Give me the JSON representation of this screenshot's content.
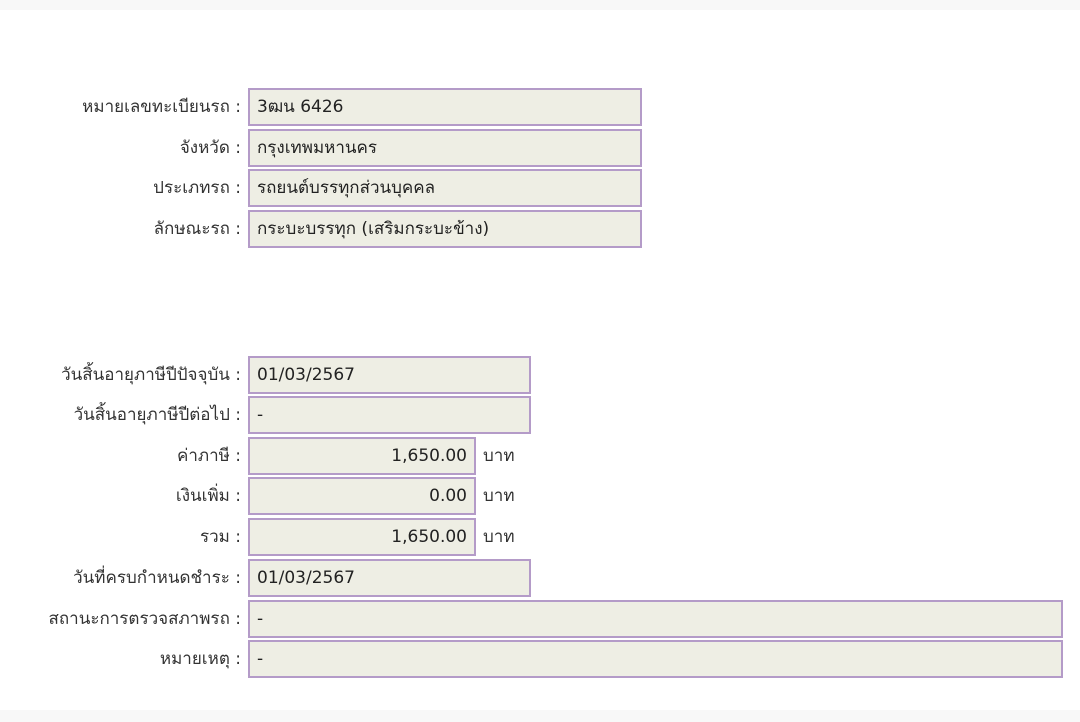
{
  "vehicle": {
    "plate": {
      "label": "หมายเลขทะเบียนรถ :",
      "value": "3ฒน 6426"
    },
    "province": {
      "label": "จังหวัด :",
      "value": "กรุงเทพมหานคร"
    },
    "type": {
      "label": "ประเภทรถ :",
      "value": "รถยนต์บรรทุกส่วนบุคคล"
    },
    "style": {
      "label": "ลักษณะรถ :",
      "value": "กระบะบรรทุก (เสริมกระบะข้าง)"
    }
  },
  "tax": {
    "current_expiry": {
      "label": "วันสิ้นอายุภาษีปีปัจจุบัน :",
      "value": "01/03/2567"
    },
    "next_expiry": {
      "label": "วันสิ้นอายุภาษีปีต่อไป :",
      "value": "-"
    },
    "tax_amount": {
      "label": "ค่าภาษี :",
      "value": "1,650.00",
      "unit": "บาท"
    },
    "surcharge": {
      "label": "เงินเพิ่ม :",
      "value": "0.00",
      "unit": "บาท"
    },
    "total": {
      "label": "รวม :",
      "value": "1,650.00",
      "unit": "บาท"
    },
    "due_date": {
      "label": "วันที่ครบกำหนดชำระ :",
      "value": "01/03/2567"
    },
    "inspection_status": {
      "label": "สถานะการตรวจสภาพรถ :",
      "value": "-"
    },
    "remark": {
      "label": "หมายเหตุ :",
      "value": "-"
    }
  }
}
